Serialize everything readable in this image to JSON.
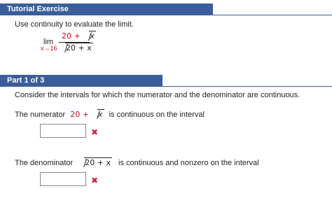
{
  "header": {
    "title": "Tutorial Exercise"
  },
  "prompt": "Use continuity to evaluate the limit.",
  "limit": {
    "lim_word": "lim",
    "approach": "x→16",
    "num_const": "20 +",
    "num_var": "x",
    "den_expr": "20 + x"
  },
  "part": {
    "label": "Part 1 of 3",
    "instruction": "Consider the intervals for which the numerator and the denominator are continuous.",
    "numerator_line": {
      "prefix": "The numerator",
      "expr_const": "20 +",
      "expr_var": "x",
      "suffix": "is continuous on the interval"
    },
    "denominator_line": {
      "prefix": "The denominator",
      "expr": "20 + x",
      "suffix": "is continuous and nonzero on the interval"
    }
  },
  "answers": [
    {
      "value": "",
      "status": "incorrect",
      "mark": "✖"
    },
    {
      "value": "",
      "status": "incorrect",
      "mark": "✖"
    }
  ]
}
